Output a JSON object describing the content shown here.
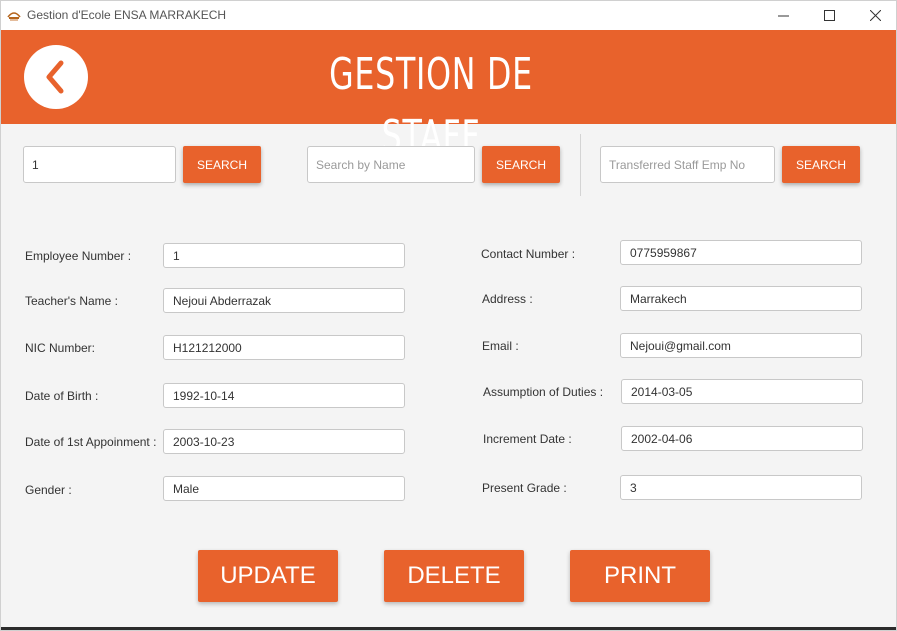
{
  "window": {
    "title": "Gestion d'Ecole ENSA MARRAKECH",
    "minimize_label": "—",
    "maximize_label": "☐",
    "close_label": "✕"
  },
  "header": {
    "title": "GESTION DE STAFF",
    "back_icon": "chevron-left-icon",
    "color": "#e8622c"
  },
  "search": {
    "emp_no": {
      "value": "1",
      "button": "SEARCH"
    },
    "name": {
      "placeholder": "Search by Name",
      "button": "SEARCH"
    },
    "transferred": {
      "placeholder": "Transferred Staff Emp No",
      "button": "SEARCH"
    }
  },
  "form": {
    "left": [
      {
        "label": "Employee Number :",
        "value": "1"
      },
      {
        "label": "Teacher's Name :",
        "value": "Nejoui Abderrazak"
      },
      {
        "label": "NIC Number:",
        "value": "H121212000"
      },
      {
        "label": "Date of Birth :",
        "value": "1992-10-14"
      },
      {
        "label": "Date of 1st Appoinment :",
        "value": "2003-10-23"
      },
      {
        "label": "Gender :",
        "value": "Male"
      }
    ],
    "right": [
      {
        "label": "Contact Number :",
        "value": "0775959867"
      },
      {
        "label": "Address :",
        "value": "Marrakech"
      },
      {
        "label": "Email :",
        "value": "Nejoui@gmail.com"
      },
      {
        "label": "Assumption of Duties :",
        "value": "2014-03-05"
      },
      {
        "label": "Increment Date :",
        "value": "2002-04-06"
      },
      {
        "label": "Present Grade :",
        "value": "3"
      }
    ]
  },
  "actions": {
    "update": "UPDATE",
    "delete": "DELETE",
    "print": "PRINT"
  }
}
